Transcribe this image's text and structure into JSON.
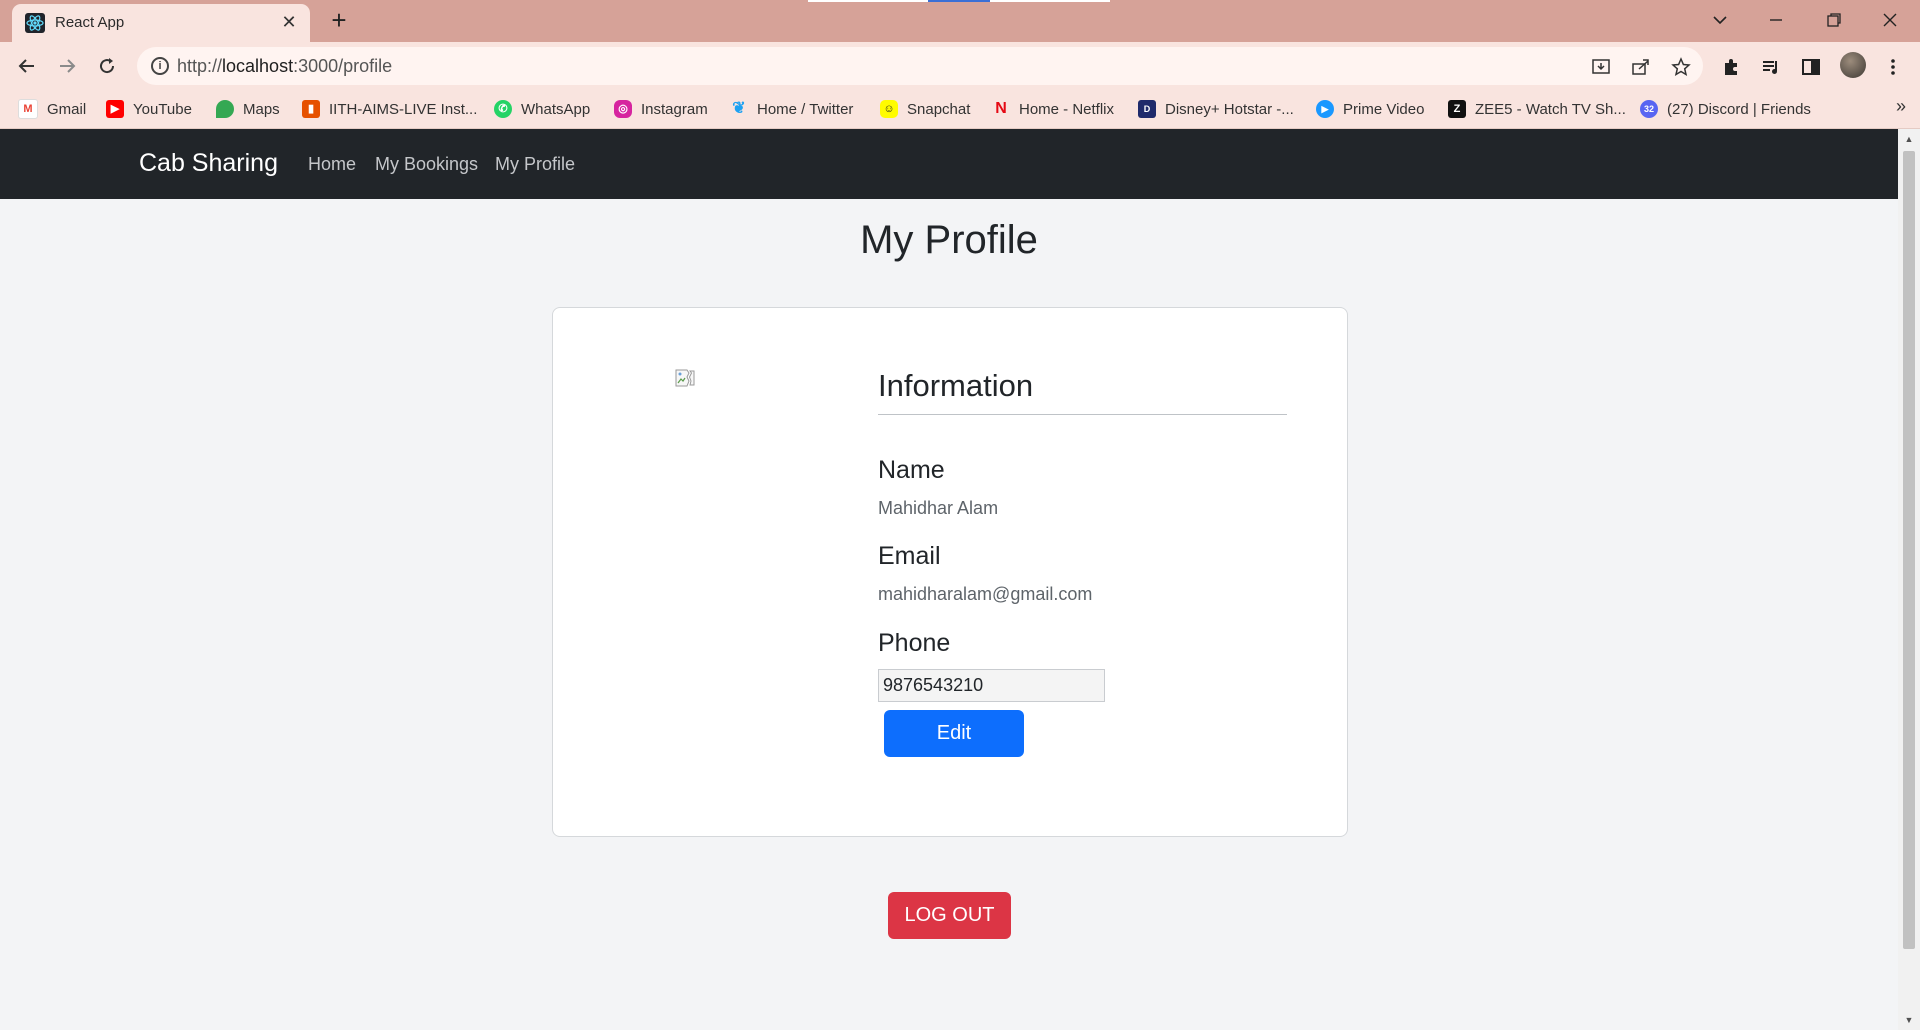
{
  "browser": {
    "tab_title": "React App",
    "url_scheme": "http://",
    "url_host": "localhost",
    "url_rest": ":3000/profile",
    "bookmarks": [
      {
        "label": "Gmail",
        "icon": "gmail-icon",
        "color": "#ea4335"
      },
      {
        "label": "YouTube",
        "icon": "youtube-icon",
        "color": "#ff0000"
      },
      {
        "label": "Maps",
        "icon": "maps-icon",
        "color": "#34a853"
      },
      {
        "label": "IITH-AIMS-LIVE Inst...",
        "icon": "gift-icon",
        "color": "#e65100"
      },
      {
        "label": "WhatsApp",
        "icon": "whatsapp-icon",
        "color": "#25d366"
      },
      {
        "label": "Instagram",
        "icon": "instagram-icon",
        "color": "#d6249f"
      },
      {
        "label": "Home / Twitter",
        "icon": "twitter-icon",
        "color": "#1da1f2"
      },
      {
        "label": "Snapchat",
        "icon": "snapchat-icon",
        "color": "#fffc00"
      },
      {
        "label": "Home - Netflix",
        "icon": "netflix-icon",
        "color": "#e50914"
      },
      {
        "label": "Disney+ Hotstar -...",
        "icon": "hotstar-icon",
        "color": "#1f2a6b"
      },
      {
        "label": "Prime Video",
        "icon": "prime-video-icon",
        "color": "#1a98ff"
      },
      {
        "label": "ZEE5 - Watch TV Sh...",
        "icon": "zee5-icon",
        "color": "#111111"
      },
      {
        "label": "(27) Discord | Friends",
        "icon": "discord-icon",
        "color": "#5865f2"
      }
    ],
    "discord_badge": "32"
  },
  "navbar": {
    "brand": "Cab Sharing",
    "links": [
      "Home",
      "My Bookings",
      "My Profile"
    ]
  },
  "page": {
    "title": "My Profile",
    "info_heading": "Information",
    "name_label": "Name",
    "name_value": "Mahidhar Alam",
    "email_label": "Email",
    "email_value": "mahidharalam@gmail.com",
    "phone_label": "Phone",
    "phone_value": "9876543210",
    "edit_label": "Edit",
    "logout_label": "LOG OUT"
  },
  "colors": {
    "navbar_bg": "#212529",
    "primary": "#0d6efd",
    "danger": "#dc3545",
    "tabstrip": "#d6a298",
    "toolbar": "#f9e4df"
  }
}
